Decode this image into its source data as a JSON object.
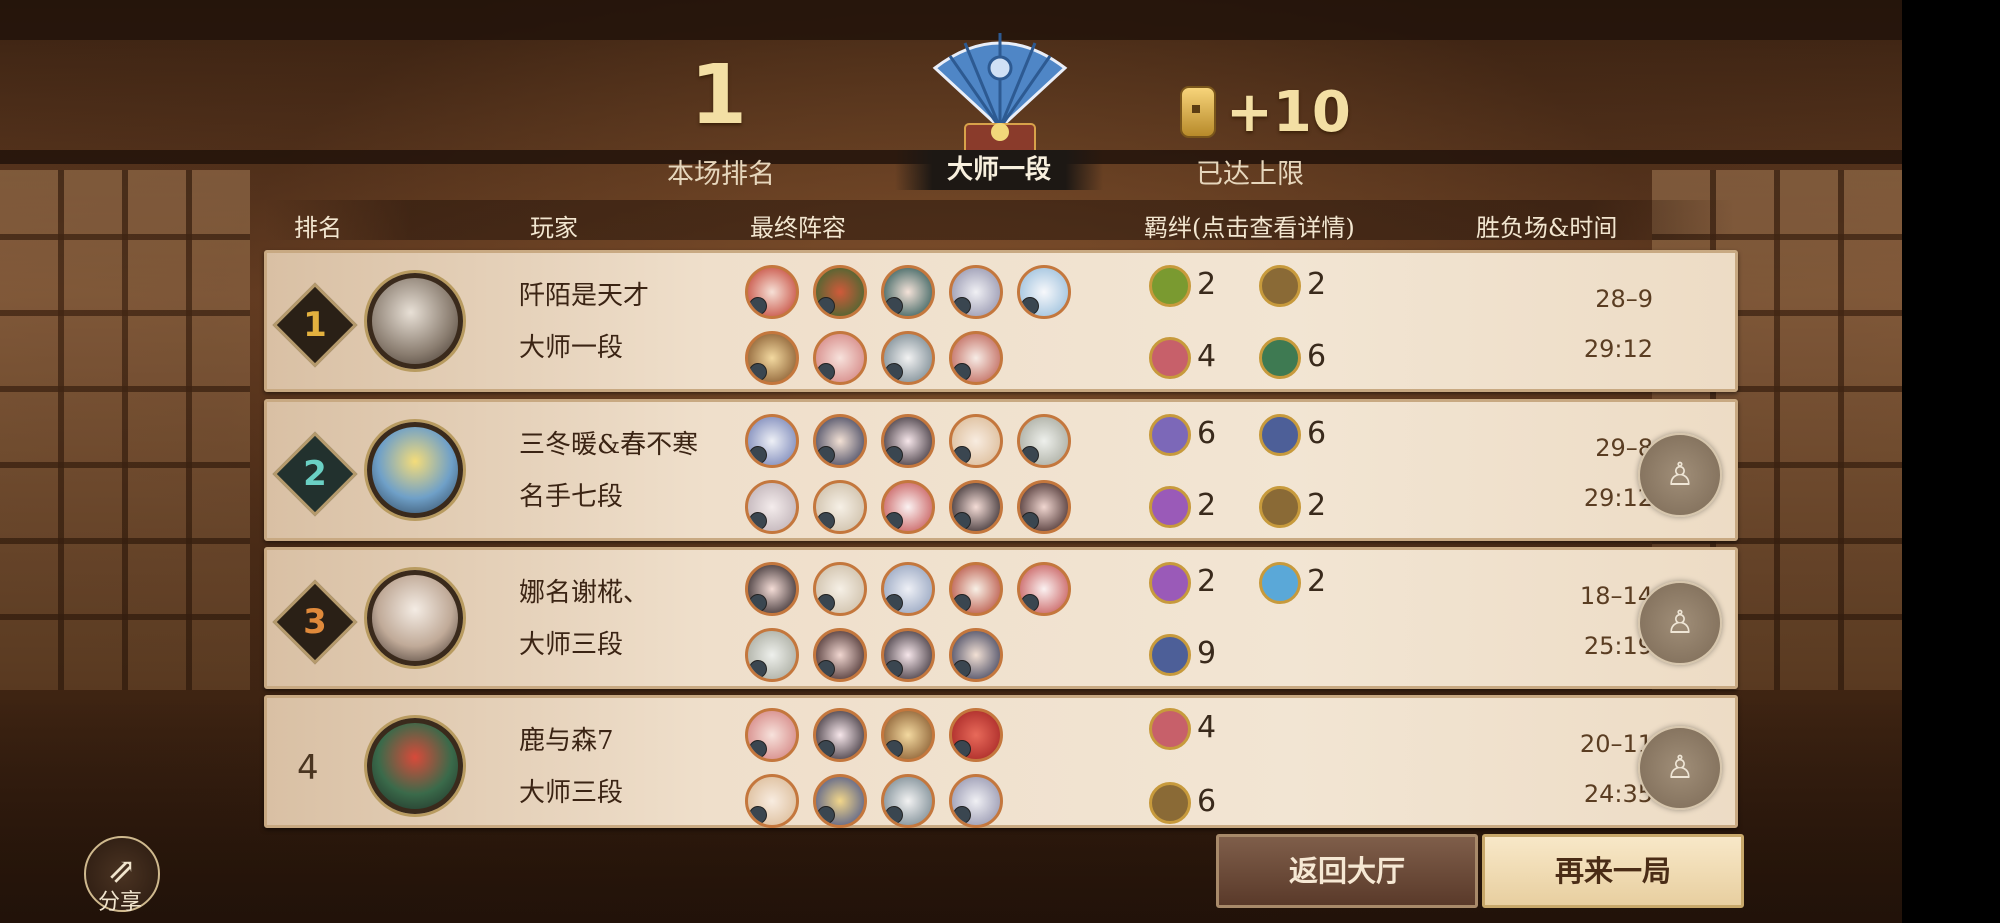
{
  "header": {
    "rank_number": "1",
    "rank_label": "本场排名",
    "tier_banner": "大师一段",
    "reward_value": "+10",
    "reward_label": "已达上限"
  },
  "table_headers": {
    "rank": "排名",
    "player": "玩家",
    "lineup": "最终阵容",
    "bonds": "羁绊(点击查看详情)",
    "record": "胜负场&时间"
  },
  "rows": [
    {
      "rank": "1",
      "name": "阡陌是天才",
      "tier": "大师一段",
      "score": "28–9",
      "time": "29:12",
      "bonds": [
        "2",
        "2",
        "4",
        "6"
      ],
      "badge_color": "#e3b13f"
    },
    {
      "rank": "2",
      "name": "三冬暖&春不寒",
      "tier": "名手七段",
      "score": "29–8",
      "time": "29:12",
      "bonds": [
        "6",
        "6",
        "2",
        "2"
      ],
      "badge_color": "#2f8f86"
    },
    {
      "rank": "3",
      "name": "娜名谢椛、",
      "tier": "大师三段",
      "score": "18–14",
      "time": "25:19",
      "bonds": [
        "2",
        "2",
        "9"
      ],
      "badge_color": "#e08a3b"
    },
    {
      "rank": "4",
      "name": "鹿与森7",
      "tier": "大师三段",
      "score": "20–11",
      "time": "24:35",
      "bonds": [
        "4",
        "6"
      ],
      "badge_color": "#4a3520"
    }
  ],
  "buttons": {
    "back": "返回大厅",
    "again": "再来一局",
    "share": "分享"
  }
}
